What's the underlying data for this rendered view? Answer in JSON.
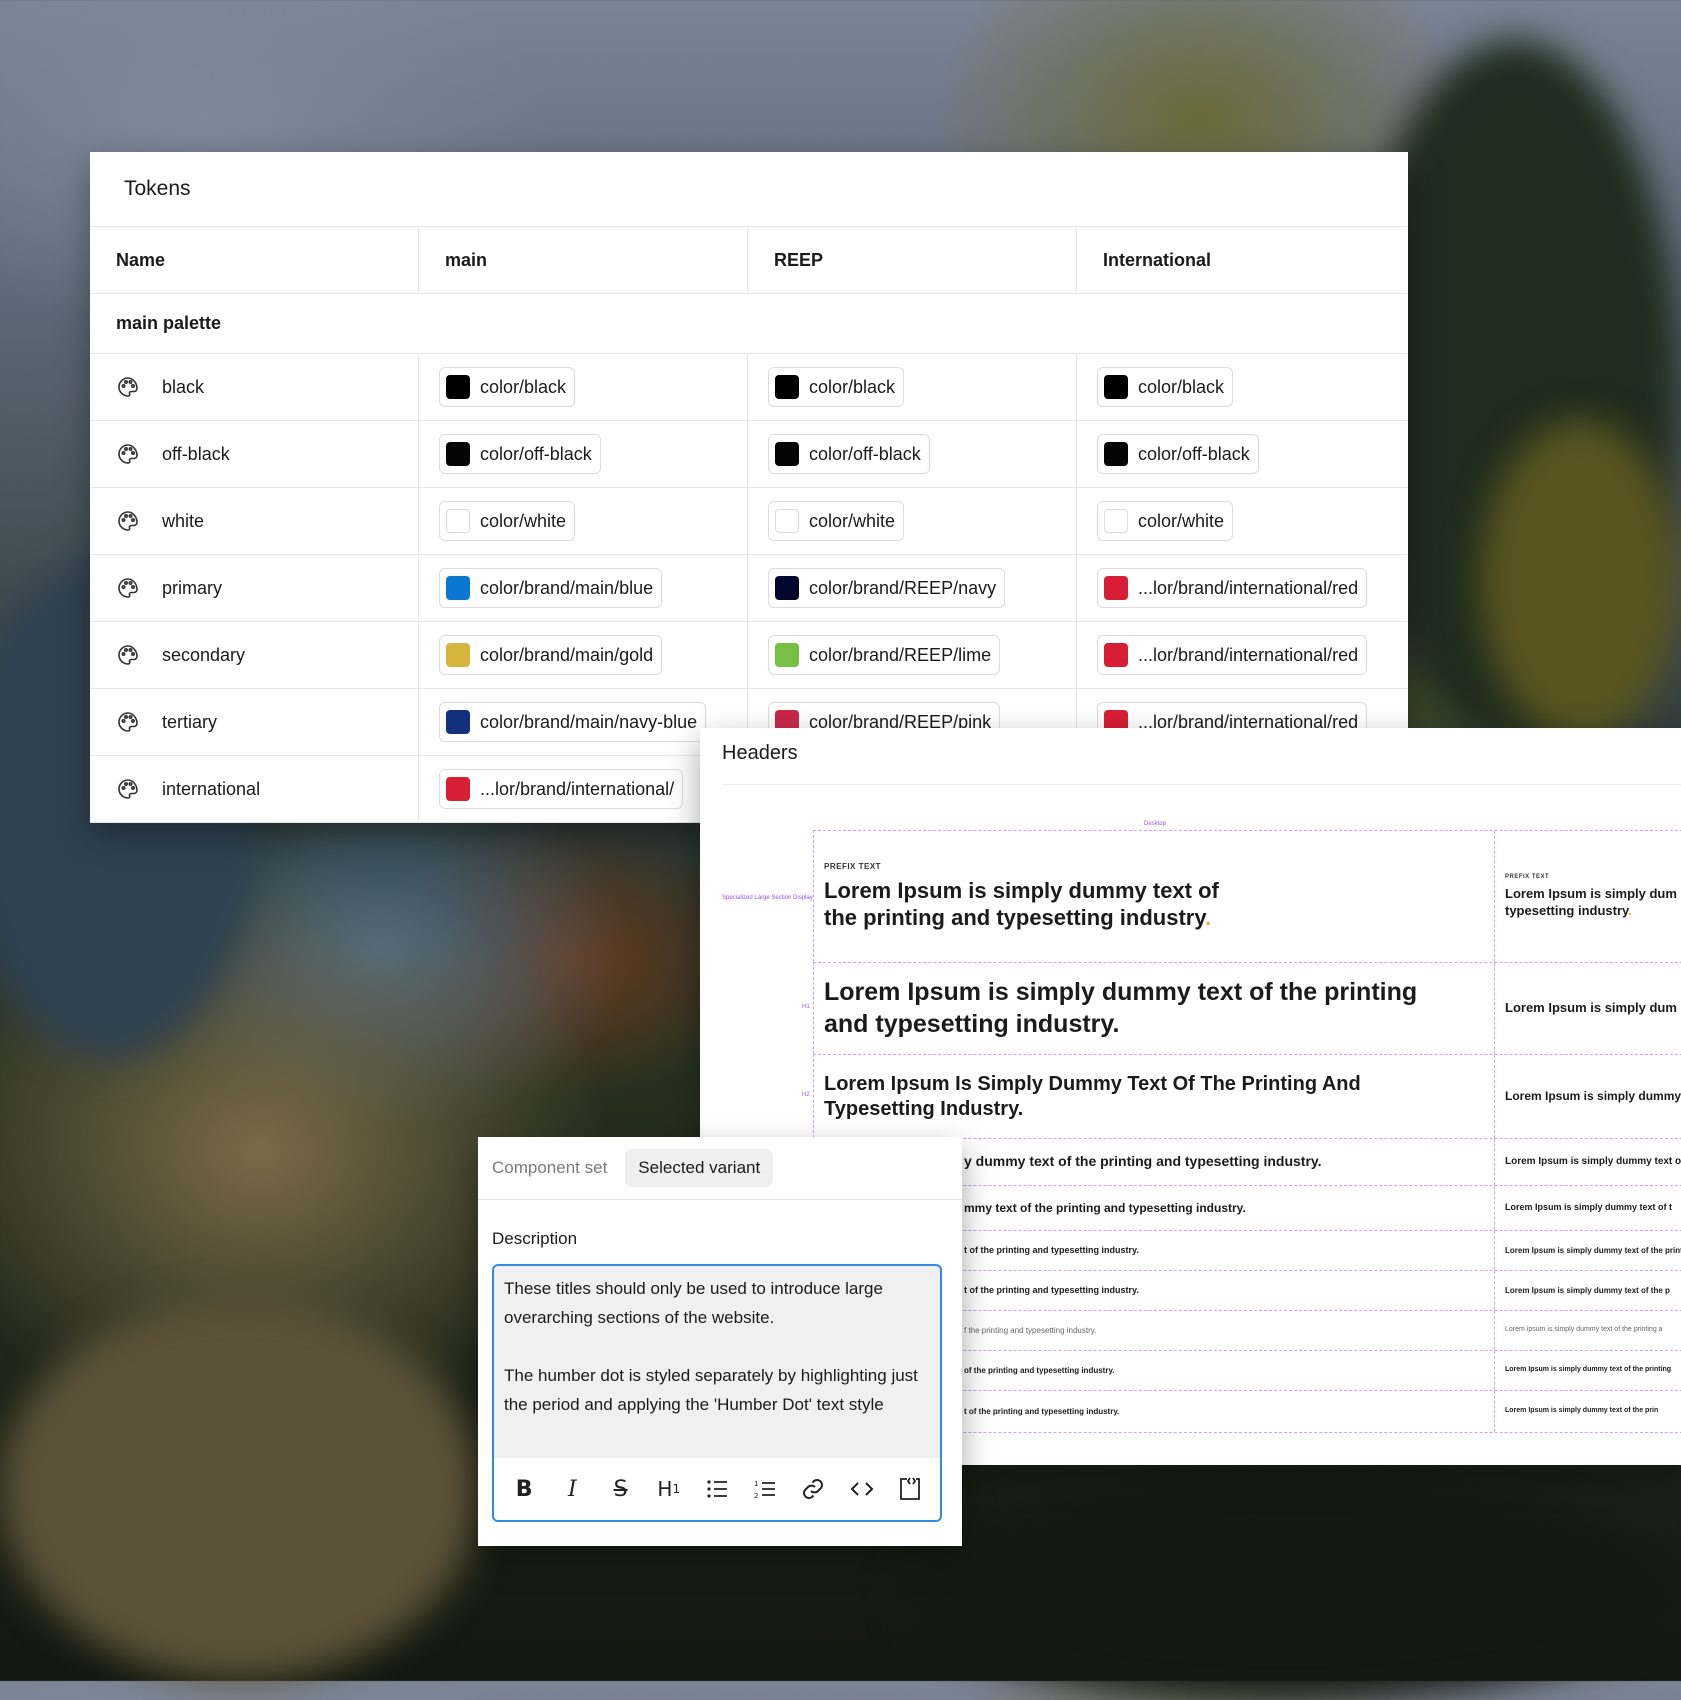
{
  "tokens": {
    "title": "Tokens",
    "columns": [
      "Name",
      "main",
      "REEP",
      "International"
    ],
    "section": "main palette",
    "rows": [
      {
        "name": "black",
        "main": {
          "label": "color/black",
          "color": "#000000"
        },
        "reep": {
          "label": "color/black",
          "color": "#000000"
        },
        "intl": {
          "label": "color/black",
          "color": "#000000"
        }
      },
      {
        "name": "off-black",
        "main": {
          "label": "color/off-black",
          "color": "#050505"
        },
        "reep": {
          "label": "color/off-black",
          "color": "#050505"
        },
        "intl": {
          "label": "color/off-black",
          "color": "#050505"
        }
      },
      {
        "name": "white",
        "main": {
          "label": "color/white",
          "color": "#ffffff"
        },
        "reep": {
          "label": "color/white",
          "color": "#ffffff"
        },
        "intl": {
          "label": "color/white",
          "color": "#ffffff"
        }
      },
      {
        "name": "primary",
        "main": {
          "label": "color/brand/main/blue",
          "color": "#0a78d0"
        },
        "reep": {
          "label": "color/brand/REEP/navy",
          "color": "#05062e"
        },
        "intl": {
          "label": "...lor/brand/international/red",
          "color": "#d81e34"
        }
      },
      {
        "name": "secondary",
        "main": {
          "label": "color/brand/main/gold",
          "color": "#d7b43e"
        },
        "reep": {
          "label": "color/brand/REEP/lime",
          "color": "#77c043"
        },
        "intl": {
          "label": "...lor/brand/international/red",
          "color": "#d81e34"
        }
      },
      {
        "name": "tertiary",
        "main": {
          "label": "color/brand/main/navy-blue",
          "color": "#13307a"
        },
        "reep": {
          "label": "color/brand/REEP/pink",
          "color": "#c8284a"
        },
        "intl": {
          "label": "...lor/brand/international/red",
          "color": "#d81e34"
        }
      },
      {
        "name": "international",
        "main": {
          "label": "...lor/brand/international/",
          "color": "#d81e34"
        }
      }
    ]
  },
  "headers": {
    "title": "Headers",
    "desktop_label": "Desktop",
    "side_labels": [
      "Specialized Large Section Display",
      "H1",
      "H2"
    ],
    "prefix": "PREFIX TEXT",
    "rows": [
      {
        "left": "Lorem Ipsum is simply dummy text of the printing and typesetting industry",
        "dot": ".",
        "right": "Lorem Ipsum is simply dum typesetting industry",
        "right_dot": "."
      },
      {
        "left": "Lorem Ipsum is simply dummy text of the printing and typesetting industry.",
        "right": "Lorem Ipsum is simply dum"
      },
      {
        "left": "Lorem Ipsum Is Simply Dummy Text Of The Printing And Typesetting Industry.",
        "right": "Lorem Ipsum is simply dummy"
      },
      {
        "left": "y dummy text of the printing and typesetting industry.",
        "right": "Lorem Ipsum is simply dummy text o"
      },
      {
        "left": "mmy text of the printing and typesetting industry.",
        "right": "Lorem Ipsum is simply dummy text of t"
      },
      {
        "left": "t of the printing and typesetting industry.",
        "right": "Lorem Ipsum is simply dummy text of the printi"
      },
      {
        "left": "t of the printing and typesetting industry.",
        "right": "Lorem Ipsum is simply dummy text of the p"
      },
      {
        "left": "f the printing and typesetting industry.",
        "right": "Lorem ipsum is simply dummy text of the printing a"
      },
      {
        "left": "of the printing and typesetting industry.",
        "right": "Lorem Ipsum is simply dummy text of the printing"
      },
      {
        "left": "t of the printing and typesetting industry.",
        "right": "Lorem Ipsum is simply dummy text of the prin"
      }
    ]
  },
  "component": {
    "tabs": [
      "Component set",
      "Selected variant"
    ],
    "description_label": "Description",
    "description_p1": "These titles should only be used to introduce large overarching sections of the website.",
    "description_p2": "The humber dot is styled separately by highlighting just the period and applying the 'Humber Dot' text style",
    "toolbar": [
      "bold-icon",
      "italic-icon",
      "strikethrough-icon",
      "heading-icon",
      "bullet-list-icon",
      "numbered-list-icon",
      "link-icon",
      "code-icon",
      "code-block-icon"
    ]
  }
}
